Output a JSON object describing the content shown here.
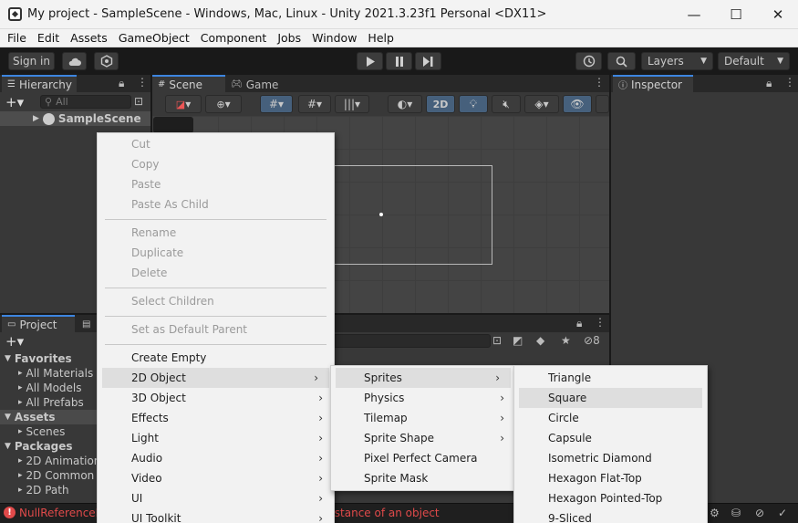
{
  "window": {
    "title": "My project - SampleScene - Windows, Mac, Linux - Unity 2021.3.23f1 Personal <DX11>",
    "minimize": "—",
    "maximize": "☐",
    "close": "✕"
  },
  "menubar": [
    "File",
    "Edit",
    "Assets",
    "GameObject",
    "Component",
    "Jobs",
    "Window",
    "Help"
  ],
  "toolbar": {
    "sign_in": "Sign in",
    "layers": "Layers",
    "layout": "Default"
  },
  "hierarchy": {
    "tab": "Hierarchy",
    "search_placeholder": "All",
    "scene": "SampleScene"
  },
  "scene": {
    "tab_scene": "Scene",
    "tab_game": "Game",
    "btn_2d": "2D"
  },
  "inspector": {
    "tab": "Inspector"
  },
  "project": {
    "tab": "Project",
    "hidden_count": "8",
    "tree": [
      {
        "label": "Favorites",
        "indent": 1,
        "bold": true
      },
      {
        "label": "All Materials",
        "indent": 2
      },
      {
        "label": "All Models",
        "indent": 2
      },
      {
        "label": "All Prefabs",
        "indent": 2
      },
      {
        "label": "Assets",
        "indent": 1,
        "bold": true
      },
      {
        "label": "Scenes",
        "indent": 2
      },
      {
        "label": "Packages",
        "indent": 1,
        "bold": true
      },
      {
        "label": "2D Animation",
        "indent": 2
      },
      {
        "label": "2D Common",
        "indent": 2
      },
      {
        "label": "2D Path",
        "indent": 2
      }
    ]
  },
  "status": {
    "error": "NullReferenceException: Object reference not set to an instance of an object"
  },
  "context_menu": {
    "items": [
      {
        "label": "Cut",
        "disabled": true
      },
      {
        "label": "Copy",
        "disabled": true
      },
      {
        "label": "Paste",
        "disabled": true
      },
      {
        "label": "Paste As Child",
        "disabled": true
      },
      {
        "label": "Rename",
        "disabled": true
      },
      {
        "label": "Duplicate",
        "disabled": true
      },
      {
        "label": "Delete",
        "disabled": true
      },
      {
        "label": "Select Children",
        "disabled": true
      },
      {
        "label": "Set as Default Parent",
        "disabled": true
      },
      {
        "label": "Create Empty"
      },
      {
        "label": "2D Object",
        "submenu": true,
        "highlighted": true
      },
      {
        "label": "3D Object",
        "submenu": true
      },
      {
        "label": "Effects",
        "submenu": true
      },
      {
        "label": "Light",
        "submenu": true
      },
      {
        "label": "Audio",
        "submenu": true
      },
      {
        "label": "Video",
        "submenu": true
      },
      {
        "label": "UI",
        "submenu": true
      },
      {
        "label": "UI Toolkit",
        "submenu": true
      }
    ]
  },
  "submenu_2d": {
    "items": [
      {
        "label": "Sprites",
        "submenu": true,
        "highlighted": true
      },
      {
        "label": "Physics",
        "submenu": true
      },
      {
        "label": "Tilemap",
        "submenu": true
      },
      {
        "label": "Sprite Shape",
        "submenu": true
      },
      {
        "label": "Pixel Perfect Camera"
      },
      {
        "label": "Sprite Mask"
      }
    ]
  },
  "submenu_sprites": {
    "items": [
      {
        "label": "Triangle"
      },
      {
        "label": "Square",
        "highlighted": true
      },
      {
        "label": "Circle"
      },
      {
        "label": "Capsule"
      },
      {
        "label": "Isometric Diamond"
      },
      {
        "label": "Hexagon Flat-Top"
      },
      {
        "label": "Hexagon Pointed-Top"
      },
      {
        "label": "9-Sliced"
      }
    ]
  },
  "colors": {
    "accent": "#3d85e0",
    "error": "#e04a4a",
    "menu_bg": "#f2f2f2"
  }
}
